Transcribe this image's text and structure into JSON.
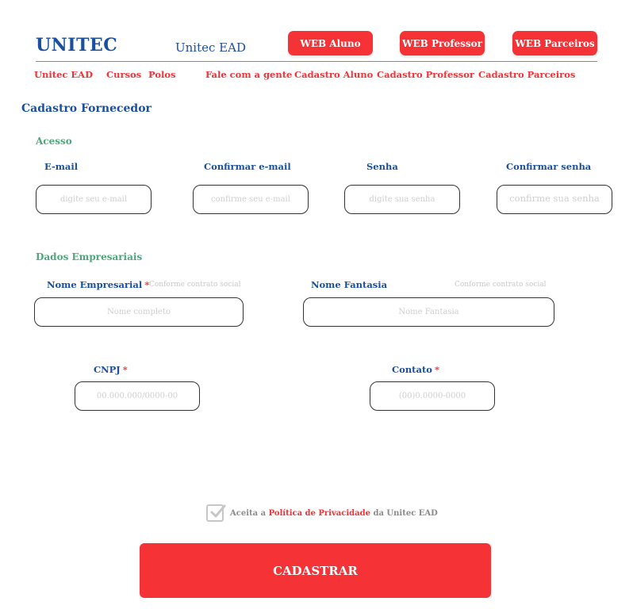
{
  "header": {
    "brand": "UNITEC",
    "subtitle": "Unitec EAD",
    "buttons": [
      "WEB Aluno",
      "WEB Professor",
      "WEB Parceiros"
    ]
  },
  "nav": [
    "Unitec EAD",
    "Cursos",
    "Polos",
    "Fale com a gente",
    "Cadastro Aluno",
    "Cadastro Professor",
    "Cadastro Parceiros"
  ],
  "page_title": "Cadastro Fornecedor",
  "acesso": {
    "title": "Acesso",
    "fields": [
      {
        "label": "E-mail",
        "placeholder": "digite seu e-mail"
      },
      {
        "label": "Confirmar e-mail",
        "placeholder": "confirme seu e-mail"
      },
      {
        "label": "Senha",
        "placeholder": "digite sua senha"
      },
      {
        "label": "Confirmar senha",
        "placeholder": "confirme sua senha"
      }
    ]
  },
  "empresa": {
    "title": "Dados Empresariais",
    "nome_empresarial": {
      "label": "Nome Empresarial",
      "required": "*",
      "hint": "Conforme contrato social",
      "placeholder": "Nome completo"
    },
    "nome_fantasia": {
      "label": "Nome Fantasia",
      "hint": "Conforme contrato social",
      "placeholder": "Nome Fantasia"
    },
    "cnpj": {
      "label": "CNPJ",
      "required": "*",
      "placeholder": "00.000.000/0000-00"
    },
    "contato": {
      "label": "Contato",
      "required": "*",
      "placeholder": "(00)0.0000-0000"
    }
  },
  "consent": {
    "prefix": "Aceita a",
    "link": "Política de Privacidade",
    "suffix": "da Unitec EAD",
    "checked": true
  },
  "submit_label": "CADASTRAR",
  "colors": {
    "brand_blue": "#1b4fa0",
    "accent_red": "#f53337",
    "section_green": "#4fa67a"
  }
}
